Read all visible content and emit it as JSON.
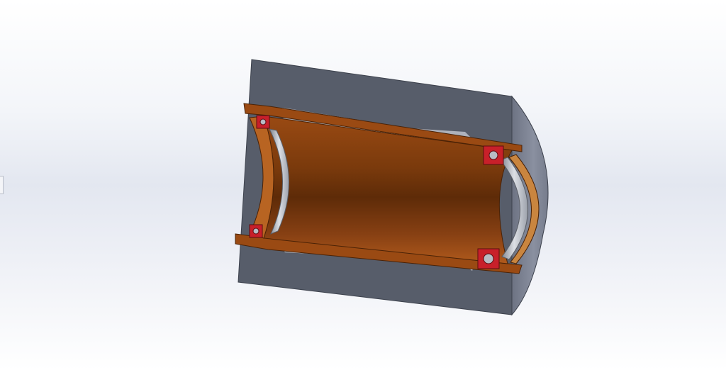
{
  "app": {
    "type": "cad-model-viewport"
  },
  "model": {
    "subject": "bearing-housing-section-view",
    "colors": {
      "background": "#e3e7f0",
      "housing": "#575d6a",
      "housing_end": "#7a8090",
      "housing_bore": "#c9ccd6",
      "sleeve": "#a85318",
      "sleeve_dark": "#5e2b08",
      "bearing_seal": "#c8202a",
      "bearing_race": "#b8bcc4"
    }
  }
}
